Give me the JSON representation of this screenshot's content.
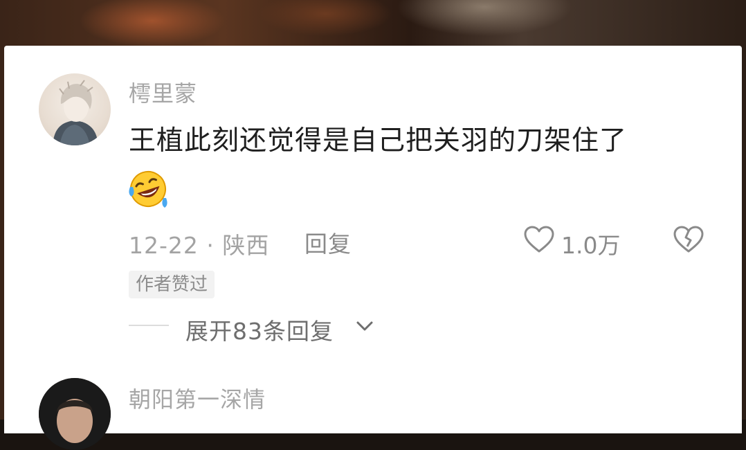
{
  "comments": [
    {
      "username": "樗里蒙",
      "text": "王植此刻还觉得是自己把关羽的刀架住了",
      "emoji_icon": "rolling-on-floor-laughing-emoji",
      "date_location": "12-22 · 陕西",
      "reply_label": "回复",
      "like_count": "1.0万",
      "author_badge": "作者赞过",
      "expand_replies": "展开83条回复"
    },
    {
      "username": "朝阳第一深情"
    }
  ],
  "colors": {
    "username": "#a6a6a6",
    "text": "#1f1f1f",
    "meta": "#a3a3a3",
    "background": "#ffffff"
  }
}
